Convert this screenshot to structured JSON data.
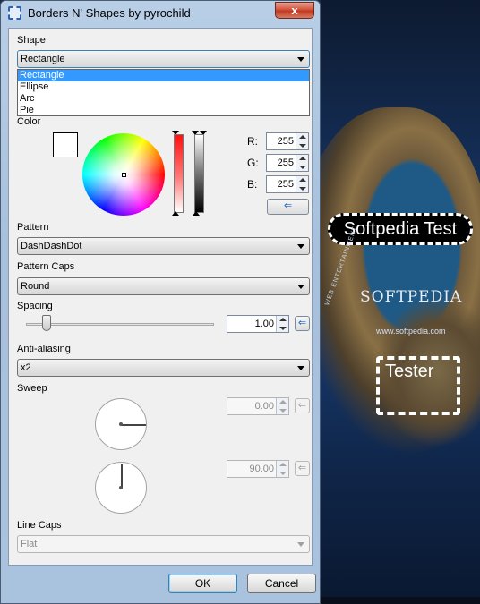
{
  "window": {
    "title": "Borders N' Shapes by pyrochild",
    "close_glyph": "x"
  },
  "shape": {
    "label": "Shape",
    "selected": "Rectangle",
    "options": [
      "Rectangle",
      "Ellipse",
      "Arc",
      "Pie"
    ],
    "highlighted_index": 0
  },
  "color": {
    "label": "Color",
    "preview_color": "#ffffff",
    "r_label": "R:",
    "g_label": "G:",
    "b_label": "B:",
    "r": "255",
    "g": "255",
    "b": "255",
    "apply_glyph": "⇐"
  },
  "pattern": {
    "label": "Pattern",
    "selected": "DashDashDot"
  },
  "pattern_caps": {
    "label": "Pattern Caps",
    "selected": "Round"
  },
  "spacing": {
    "label": "Spacing",
    "value": "1.00",
    "slider_fraction": 0.11
  },
  "antialiasing": {
    "label": "Anti-aliasing",
    "selected": "x2"
  },
  "sweep": {
    "label": "Sweep",
    "start": "0.00",
    "sweep": "90.00"
  },
  "line_caps": {
    "label": "Line Caps",
    "selected": "Flat"
  },
  "buttons": {
    "ok": "OK",
    "cancel": "Cancel"
  },
  "background": {
    "badge_text": "Softpedia Test",
    "logo": "SOFTPEDIA",
    "url": "www.softpedia.com",
    "side_text": "WEB ENTERTAINMENT",
    "tester_text": "Tester"
  }
}
